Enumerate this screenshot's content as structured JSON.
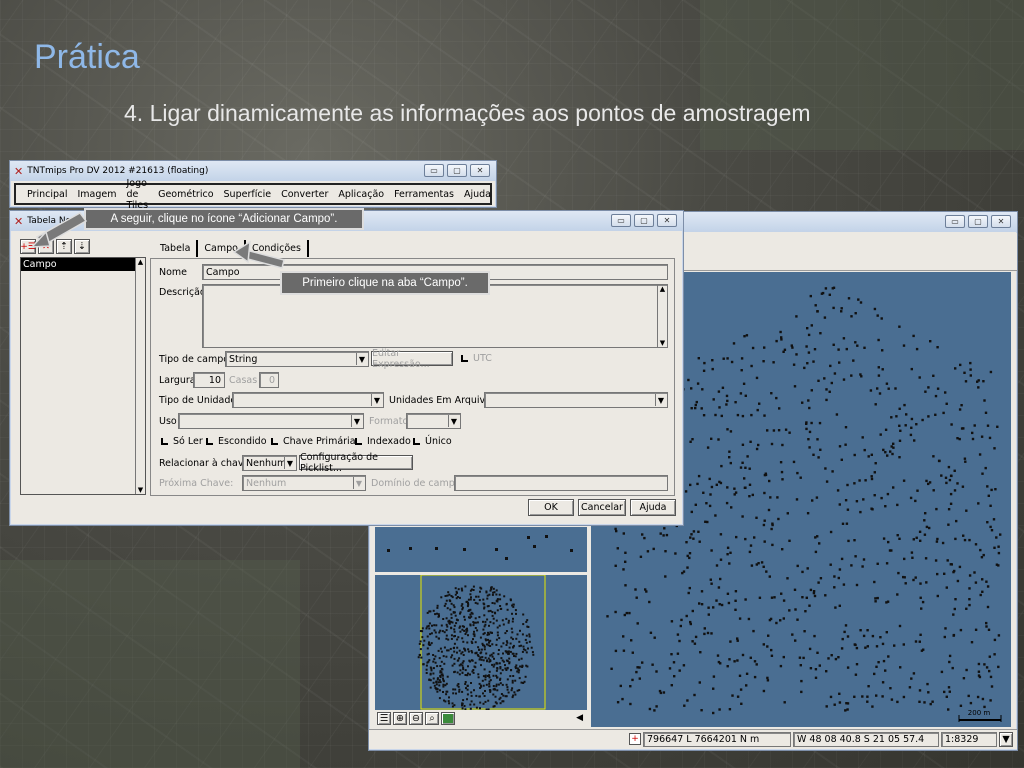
{
  "slide": {
    "title": "Prática",
    "subtitle": "4. Ligar dinamicamente as informações aos pontos de amostragem"
  },
  "main_window": {
    "title": "TNTmips Pro DV 2012  #21613 (floating)",
    "menu": [
      "Principal",
      "Imagem",
      "Jogo de Tiles",
      "Geométrico",
      "Superfície",
      "Converter",
      "Aplicação",
      "Ferramentas",
      "Ajuda"
    ]
  },
  "table_window": {
    "title": "Tabela Nova",
    "field_list": [
      "Campo"
    ],
    "tabs": [
      "Tabela",
      "Campo",
      "Condições"
    ],
    "active_tab": "Campo",
    "labels": {
      "nome": "Nome",
      "descricao": "Descrição",
      "tipo_campo": "Tipo de campo:",
      "largura": "Largura",
      "casas": "Casas",
      "tipo_unidade": "Tipo de Unidade:",
      "unidades_arquivo": "Unidades Em Arquivo:",
      "uso": "Uso",
      "formato": "Formato",
      "relacionar": "Relacionar à chave:",
      "proxima_chave": "Próxima Chave:",
      "dominio": "Domínio de campo:"
    },
    "values": {
      "nome": "Campo",
      "tipo_campo": "String",
      "largura": "10",
      "casas": "0",
      "relacionar": "Nenhum",
      "proxima_chave": "Nenhum"
    },
    "buttons": {
      "editar_expressao": "Editar Expressão...",
      "utc": "UTC",
      "configuracao_picklist": "Configuração de Picklist...",
      "ok": "OK",
      "cancelar": "Cancelar",
      "ajuda": "Ajuda"
    },
    "checkboxes": [
      "Só Ler",
      "Escondido",
      "Chave Primária",
      "Indexado",
      "Único"
    ]
  },
  "callouts": {
    "add_field": "A seguir, clique no ícone “Adicionar Campo”.",
    "campo_tab": "Primeiro clique na aba “Campo”."
  },
  "map_window": {
    "scale_label": "200 m",
    "coords": "796647 L  7664201 N m",
    "latlon": "W 48 08 40.8  S 21 05 57.4",
    "scale": "1:8329"
  },
  "colors": {
    "map_bg": "#4a6e92",
    "title_blue": "#8fb8e8",
    "callout_bg": "#6a6a6a"
  }
}
